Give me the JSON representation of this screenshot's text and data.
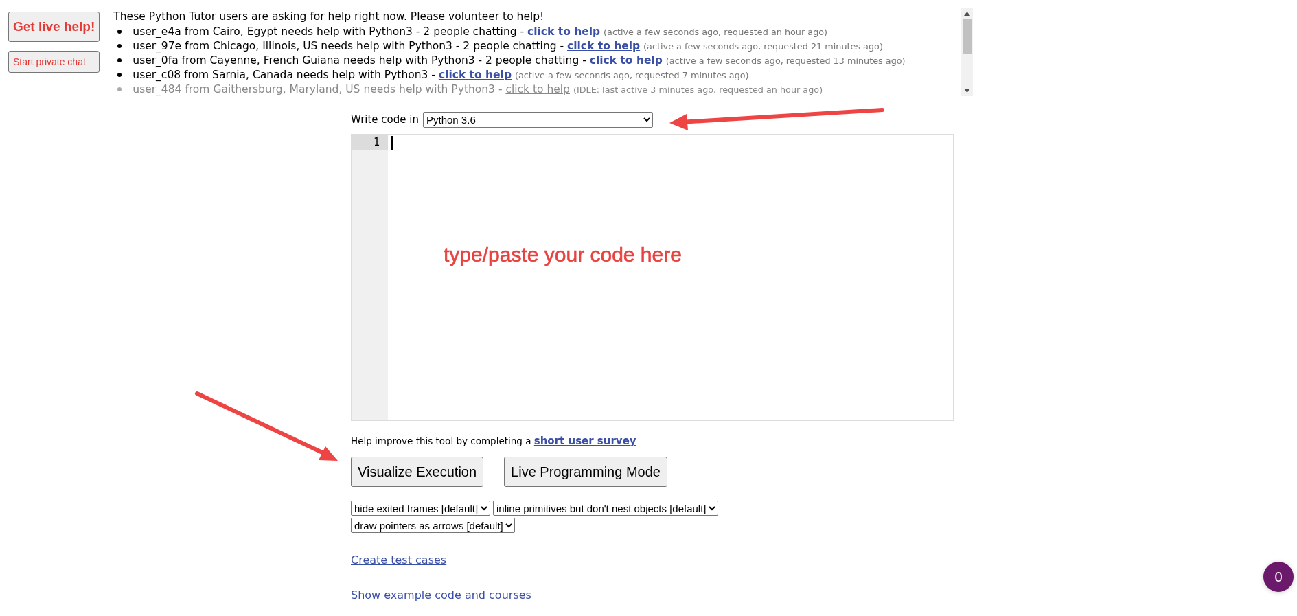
{
  "help_buttons": [
    {
      "label": "Get live help!",
      "kind": "primary"
    },
    {
      "label": "Start private chat",
      "kind": "secondary"
    }
  ],
  "help_requests": {
    "heading": "These Python Tutor users are asking for help right now. Please volunteer to help!",
    "items": [
      {
        "text": "user_e4a from Cairo, Egypt needs help with Python3 - 2 people chatting -",
        "link": "click to help",
        "meta": "(active a few seconds ago, requested an hour ago)",
        "idle": false
      },
      {
        "text": "user_97e from Chicago, Illinois, US needs help with Python3 - 2 people chatting -",
        "link": "click to help",
        "meta": "(active a few seconds ago, requested 21 minutes ago)",
        "idle": false
      },
      {
        "text": "user_0fa from Cayenne, French Guiana needs help with Python3 - 2 people chatting -",
        "link": "click to help",
        "meta": "(active a few seconds ago, requested 13 minutes ago)",
        "idle": false
      },
      {
        "text": "user_c08 from Sarnia, Canada needs help with Python3 -",
        "link": "click to help",
        "meta": "(active a few seconds ago, requested 7 minutes ago)",
        "idle": false
      },
      {
        "text": "user_484 from Gaithersburg, Maryland, US needs help with Python3 -",
        "link": "click to help",
        "meta": "(IDLE: last active 3 minutes ago, requested an hour ago)",
        "idle": true
      }
    ]
  },
  "language": {
    "label": "Write code in",
    "value": "Python 3.6"
  },
  "editor": {
    "line_numbers": [
      "1"
    ],
    "annotation": "type/paste your code here"
  },
  "survey": {
    "text": "Help improve this tool by completing a",
    "link": "short user survey"
  },
  "actions": [
    "Visualize Execution",
    "Live Programming Mode"
  ],
  "display_options": [
    "hide exited frames [default]",
    "inline primitives but don't nest objects [default]",
    "draw pointers as arrows [default]"
  ],
  "links": [
    "Create test cases",
    "Show example code and courses"
  ],
  "chat_badge": "0"
}
